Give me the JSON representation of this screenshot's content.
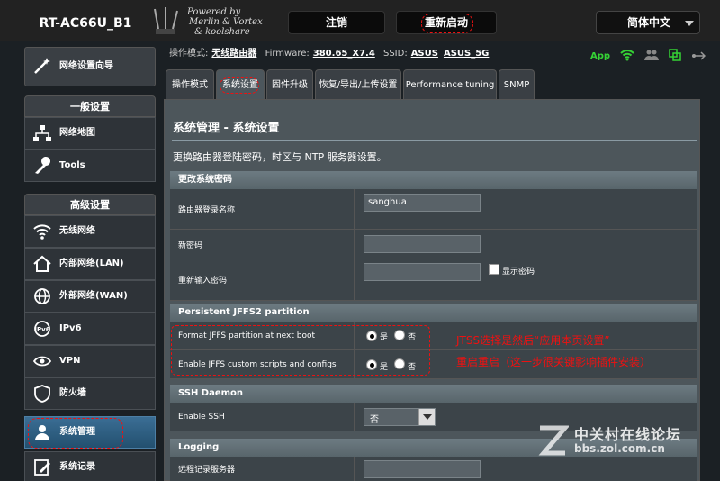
{
  "header": {
    "model": "RT-AC66U_B1",
    "brand_line1": "Powered by",
    "brand_line2": "Merlin & Vortex",
    "brand_line3": "& koolshare",
    "logout_label": "注销",
    "reboot_label": "重新启动",
    "language": "简体中文"
  },
  "status": {
    "mode_label": "操作模式:",
    "mode_value": "无线路由器",
    "firmware_label": "Firmware:",
    "firmware_value": "380.65_X7.4",
    "ssid_label": "SSID:",
    "ssid1": "ASUS",
    "ssid2": "ASUS_5G",
    "app_label": "App"
  },
  "sidebar": {
    "wizard": "网络设置向导",
    "general_header": "一般设置",
    "general_items": [
      "网络地图",
      "Tools"
    ],
    "advanced_header": "高级设置",
    "advanced_items": [
      "无线网络",
      "内部网络(LAN)",
      "外部网络(WAN)",
      "IPv6",
      "VPN",
      "防火墙",
      "系统管理",
      "系统记录"
    ]
  },
  "tabs": [
    "操作模式",
    "系统设置",
    "固件升级",
    "恢复/导出/上传设置",
    "Performance tuning",
    "SNMP"
  ],
  "panel": {
    "title": "系统管理 - 系统设置",
    "desc": "更换路由器登陆密码，时区与 NTP 服务器设置。",
    "sec_password": "更改系统密码",
    "login_name_label": "路由器登录名称",
    "login_name_value": "sanghua",
    "new_password_label": "新密码",
    "reenter_label": "重新输入密码",
    "show_password": "显示密码",
    "sec_jffs": "Persistent JFFS2 partition",
    "format_jffs_label": "Format JFFS partition at next boot",
    "enable_jffs_label": "Enable JFFS custom scripts and configs",
    "yes": "是",
    "no": "否",
    "sec_ssh": "SSH Daemon",
    "enable_ssh_label": "Enable SSH",
    "enable_ssh_value": "否",
    "sec_logging": "Logging",
    "remote_log_label": "远程记录服务器"
  },
  "annotation": {
    "line1": "JTSS选择是然后“应用本页设置”",
    "line2": "重启重启（这一步很关键影响插件安装）"
  },
  "watermark": {
    "title": "中关村在线论坛",
    "url": "bbs.zol.com.cn"
  },
  "colors": {
    "accent_red": "#e11111",
    "active_blue": "#3b6e95",
    "wifi_green": "#35d235"
  }
}
